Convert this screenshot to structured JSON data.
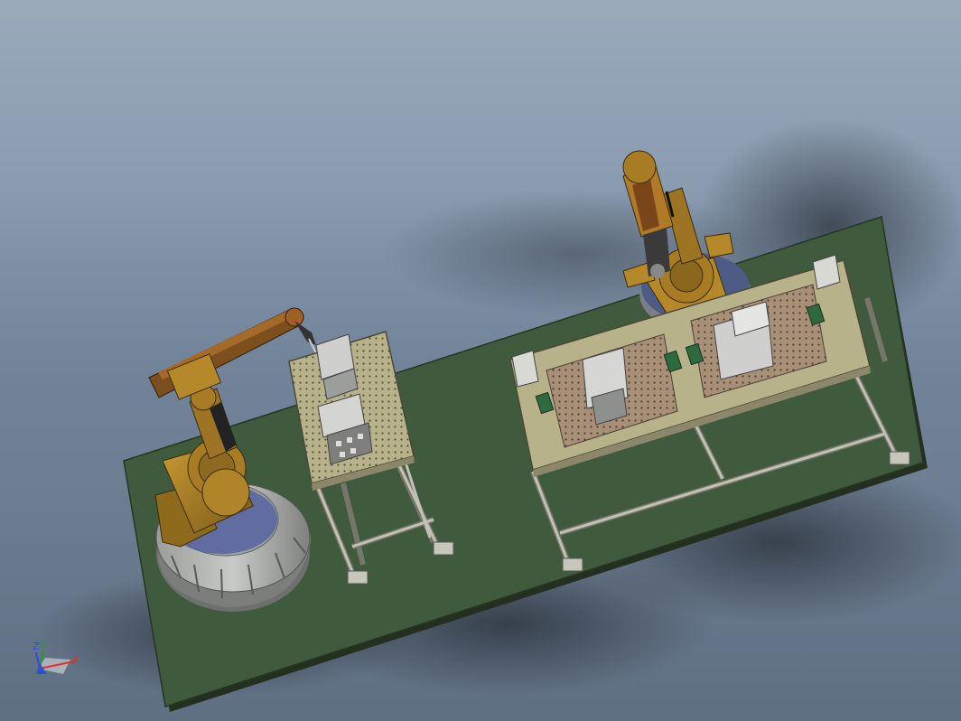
{
  "viewport": {
    "background_top": "#9aaabb",
    "background_bottom": "#5f6f82"
  },
  "scene": {
    "platform_color": "#3f5a3c",
    "robot_color": "#b5892a",
    "frame_color": "#a9a89a",
    "table_top_color": "#b7b28a",
    "base_color": "#8e918d"
  },
  "triad": {
    "x_label": "X",
    "y_label": "Y",
    "z_label": "Z",
    "x_color": "#e23030",
    "y_color": "#22a022",
    "z_color": "#3050d0"
  }
}
